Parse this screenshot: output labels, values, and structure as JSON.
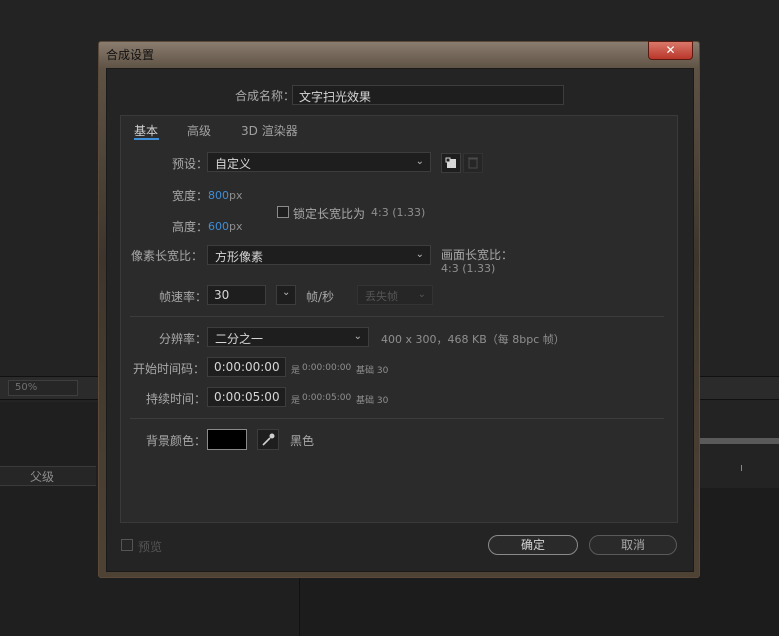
{
  "background": {
    "zoom": "50%",
    "parent_col": "父级"
  },
  "dialog": {
    "title": "合成设置",
    "close": "✕",
    "name_label": "合成名称：",
    "name_value": "文字扫光效果",
    "tabs": [
      {
        "label": "基本",
        "active": true
      },
      {
        "label": "高级",
        "active": false
      },
      {
        "label": "3D 渲染器",
        "active": false
      }
    ],
    "preset": {
      "label": "预设：",
      "value": "自定义"
    },
    "width": {
      "label": "宽度：",
      "value": "800",
      "unit": "px"
    },
    "height": {
      "label": "高度：",
      "value": "600",
      "unit": "px"
    },
    "lock_ratio": {
      "label": "锁定长宽比为",
      "ratio": "4:3 (1.33)",
      "checked": false
    },
    "pixel_aspect": {
      "label": "像素长宽比：",
      "value": "方形像素"
    },
    "frame_aspect": {
      "label": "画面长宽比：",
      "value": "4:3 (1.33)"
    },
    "frame_rate": {
      "label": "帧速率：",
      "value": "30",
      "unit": "帧/秒",
      "drop_frame": "丢失帧"
    },
    "resolution": {
      "label": "分辨率：",
      "value": "二分之一",
      "info": "400 x 300，468 KB（每 8bpc 帧）"
    },
    "start_timecode": {
      "label": "开始时间码：",
      "value": "0:00:00:00",
      "info_prefix": "是",
      "info_value": "0:00:00:00",
      "info_base": "基础 30"
    },
    "duration": {
      "label": "持续时间：",
      "value": "0:00:05:00",
      "info_prefix": "是",
      "info_value": "0:00:05:00",
      "info_base": "基础 30"
    },
    "bg_color": {
      "label": "背景颜色：",
      "name": "黑色",
      "hex": "#000000"
    },
    "preview_label": "预览",
    "ok_label": "确定",
    "cancel_label": "取消"
  },
  "icons": {
    "close": "close-icon",
    "chevron": "chevron-down-icon",
    "save_preset": "save-preset-icon",
    "delete_preset": "trash-icon",
    "eyedropper": "eyedropper-icon"
  },
  "colors": {
    "accent": "#3f8ed8",
    "panel": "#2b2b2b",
    "window_frame": "#5e5244"
  }
}
